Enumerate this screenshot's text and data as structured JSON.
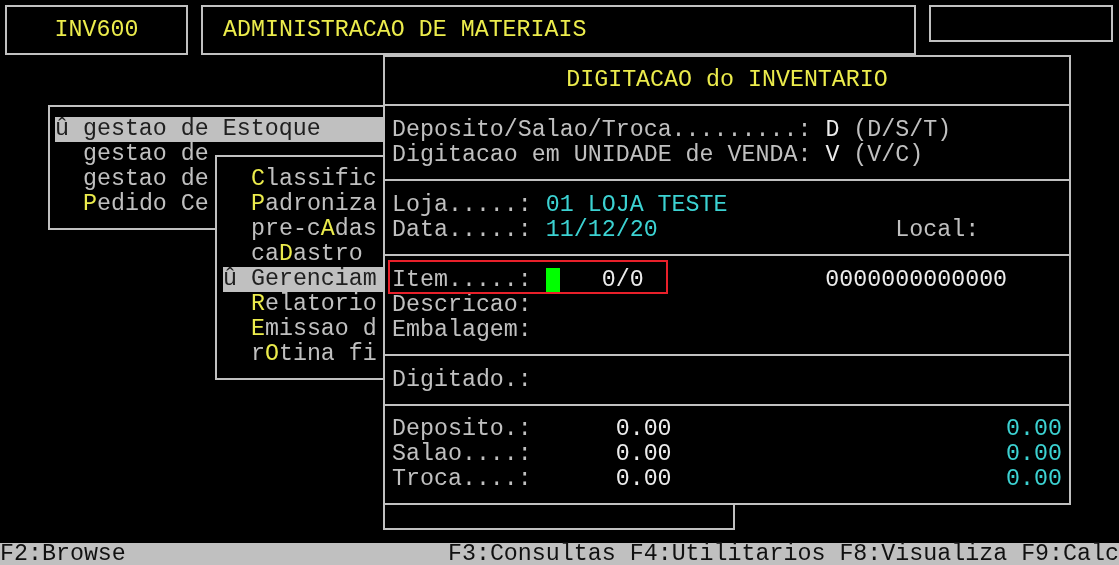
{
  "header": {
    "program": "INV600",
    "system": "ADMINISTRACAO DE MATERIAIS"
  },
  "main_menu": {
    "items": [
      {
        "marker": "û",
        "after": "gestao de Estoque",
        "selected": true
      },
      {
        "after": "gestao de",
        "selected": false
      },
      {
        "after": "gestao de",
        "selected": false
      },
      {
        "hotkey": "P",
        "after": "edido Ce",
        "selected": false
      }
    ]
  },
  "sub_menu": {
    "items": [
      {
        "hotkey": "C",
        "after": "lassific",
        "selected": false
      },
      {
        "hotkey": "P",
        "after": "adroniza",
        "selected": false
      },
      {
        "before": "pre-c",
        "hotkey": "A",
        "after": "das",
        "selected": false
      },
      {
        "before": "ca",
        "hotkey": "D",
        "after": "astro",
        "selected": false
      },
      {
        "marker": "û",
        "after": "Gerenciam",
        "selected": true
      },
      {
        "hotkey": "R",
        "after": "elatorio",
        "selected": false
      },
      {
        "hotkey": "E",
        "after": "missao d",
        "selected": false
      },
      {
        "before": "r",
        "hotkey": "O",
        "after": "tina fi",
        "selected": false
      }
    ]
  },
  "dialog": {
    "title": "DIGITACAO do INVENTARIO",
    "settings": [
      {
        "label": "Deposito/Salao/Troca.........:",
        "value": "D",
        "options": "(D/S/T)"
      },
      {
        "label": "Digitacao em UNIDADE de VENDA:",
        "value": "V",
        "options": "(V/C)"
      }
    ],
    "store": {
      "label": "Loja.....:",
      "value": "01 LOJA TESTE"
    },
    "date": {
      "label": "Data.....:",
      "value": "11/12/20",
      "local_label": "Local:"
    },
    "item": {
      "label": "Item.....:",
      "count": "0/0",
      "code": "0000000000000",
      "highlighted": true
    },
    "description_label": "Descricao:",
    "packaging_label": "Embalagem:",
    "typed_label": "Digitado.:",
    "totals": [
      {
        "label": "Deposito.:",
        "value": "0.00",
        "value_2": "0.00"
      },
      {
        "label": "Salao....:",
        "value": "0.00",
        "value_2": "0.00"
      },
      {
        "label": "Troca....:",
        "value": "0.00",
        "value_2": "0.00"
      }
    ]
  },
  "status_bar": {
    "left": "F2:Browse",
    "keys": [
      "F3:Consultas",
      "F4:Utilitarios",
      "F8:Visualiza",
      "F9:Calc"
    ]
  }
}
